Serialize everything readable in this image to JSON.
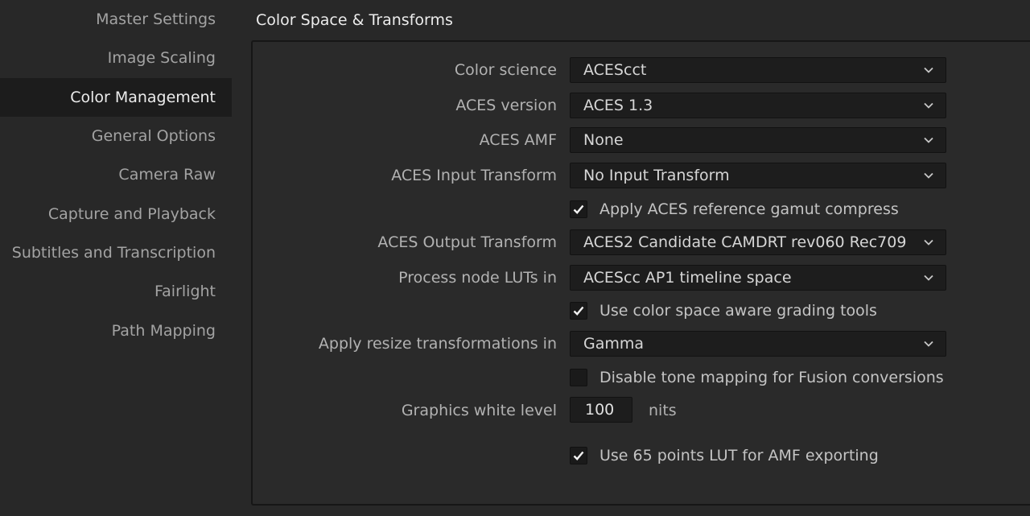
{
  "sidebar": {
    "items": [
      {
        "label": "Master Settings",
        "active": false
      },
      {
        "label": "Image Scaling",
        "active": false
      },
      {
        "label": "Color Management",
        "active": true
      },
      {
        "label": "General Options",
        "active": false
      },
      {
        "label": "Camera Raw",
        "active": false
      },
      {
        "label": "Capture and Playback",
        "active": false
      },
      {
        "label": "Subtitles and Transcription",
        "active": false
      },
      {
        "label": "Fairlight",
        "active": false
      },
      {
        "label": "Path Mapping",
        "active": false
      }
    ]
  },
  "main": {
    "title": "Color Space & Transforms",
    "color_science": {
      "label": "Color science",
      "value": "ACEScct"
    },
    "aces_version": {
      "label": "ACES version",
      "value": "ACES 1.3"
    },
    "aces_amf": {
      "label": "ACES AMF",
      "value": "None"
    },
    "aces_input_transform": {
      "label": "ACES Input Transform",
      "value": "No Input Transform"
    },
    "gamut_compress": {
      "label": "Apply ACES reference gamut compress",
      "checked": true
    },
    "aces_output_transform": {
      "label": "ACES Output Transform",
      "value": "ACES2 Candidate CAMDRT rev060 Rec709"
    },
    "process_node_luts": {
      "label": "Process node LUTs in",
      "value": "ACEScc AP1 timeline space"
    },
    "color_space_aware": {
      "label": "Use color space aware grading tools",
      "checked": true
    },
    "resize_transformations": {
      "label": "Apply resize transformations in",
      "value": "Gamma"
    },
    "disable_tone_mapping": {
      "label": "Disable tone mapping for Fusion conversions",
      "checked": false
    },
    "graphics_white_level": {
      "label": "Graphics white level",
      "value": "100",
      "unit": "nits"
    },
    "lut_65_points": {
      "label": "Use 65 points LUT for AMF exporting",
      "checked": true
    }
  },
  "colors": {
    "background": "#282828",
    "sidebar_active": "#1c1c1c",
    "field": "#1d1d1d"
  },
  "icons": {
    "dropdown": "chevron-down-icon",
    "check": "checkmark-icon"
  }
}
